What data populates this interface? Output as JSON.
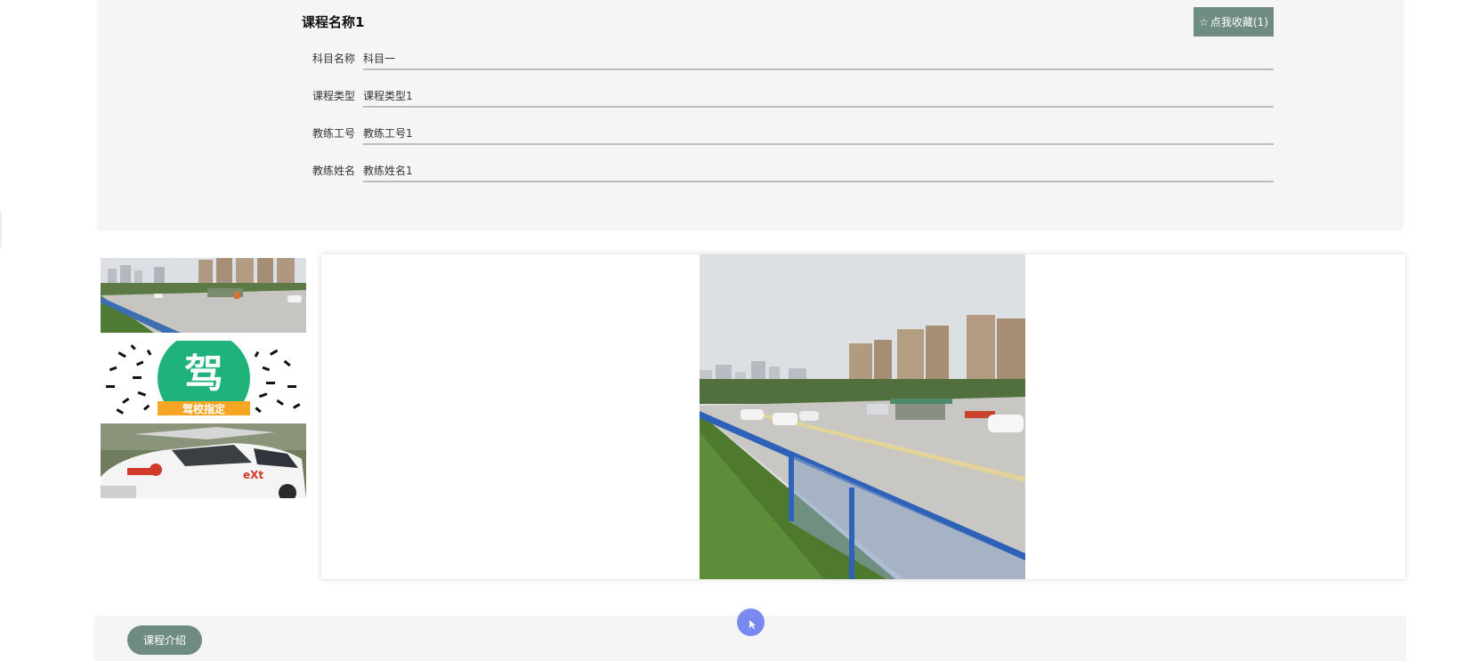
{
  "course": {
    "title": "课程名称1",
    "favorite_button": {
      "icon": "star-outline-icon",
      "label": "点我收藏(1)"
    },
    "fields": [
      {
        "label": "科目名称",
        "value": "科目一"
      },
      {
        "label": "课程类型",
        "value": "课程类型1"
      },
      {
        "label": "教练工号",
        "value": "教练工号1"
      },
      {
        "label": "教练姓名",
        "value": "教练姓名1"
      }
    ]
  },
  "gallery": {
    "thumbnails": [
      {
        "name": "driving-range-photo"
      },
      {
        "name": "jia-logo-image",
        "glyph": "驾",
        "caption": "驾校指定"
      },
      {
        "name": "training-car-photo",
        "plate_text": "eXt"
      }
    ],
    "main_image": {
      "name": "driving-range-photo"
    }
  },
  "tabs": [
    {
      "label": "课程介绍"
    }
  ],
  "colors": {
    "accent": "#6e8c82",
    "panel_bg": "#f5f5f5",
    "logo_green": "#1fb27a",
    "logo_orange": "#f6a623",
    "cursor": "#6b7ff0"
  }
}
